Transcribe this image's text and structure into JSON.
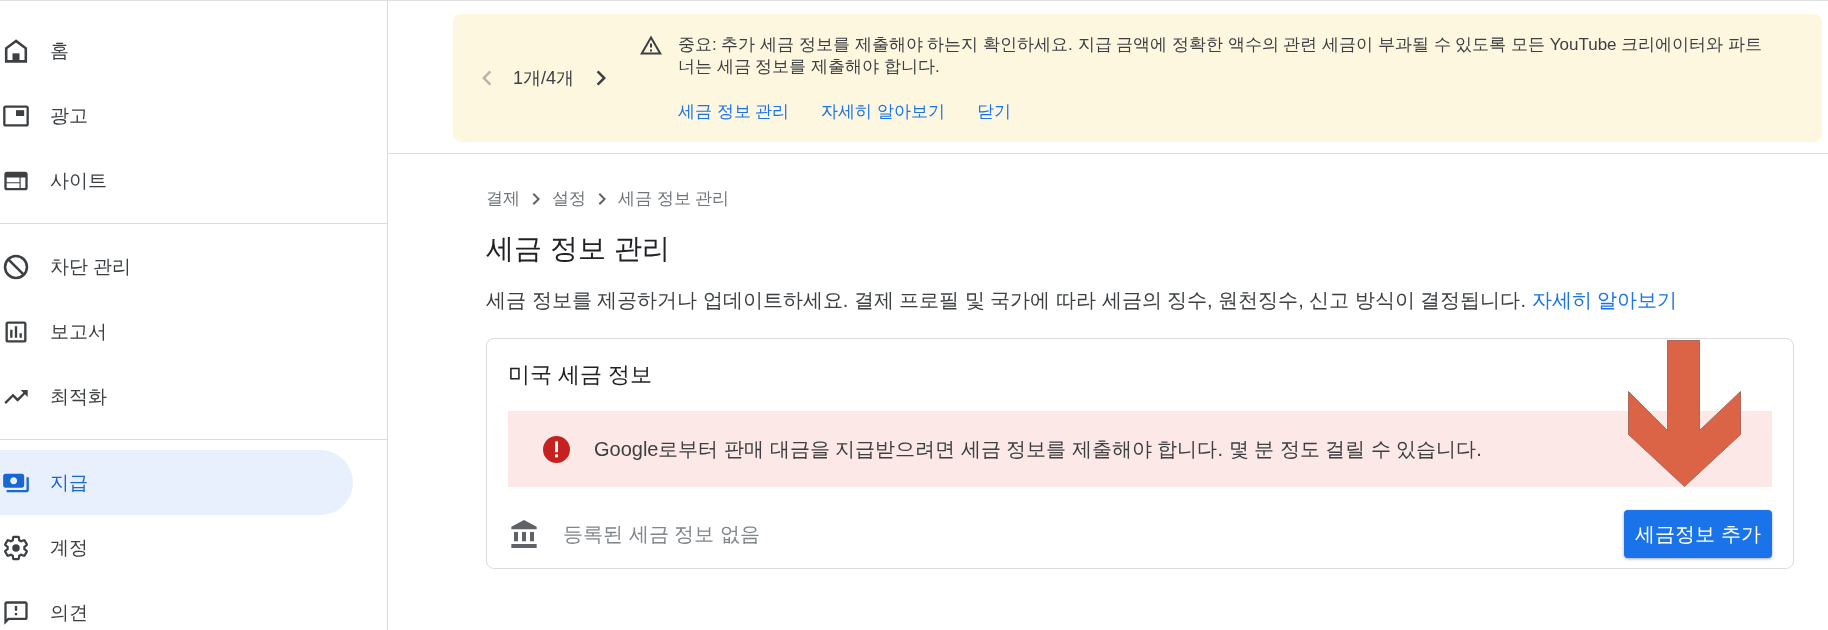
{
  "sidebar": {
    "sections": [
      {
        "items": [
          {
            "label": "홈",
            "selected": false
          },
          {
            "label": "광고",
            "selected": false
          },
          {
            "label": "사이트",
            "selected": false
          }
        ]
      },
      {
        "items": [
          {
            "label": "차단 관리",
            "selected": false
          },
          {
            "label": "보고서",
            "selected": false
          },
          {
            "label": "최적화",
            "selected": false
          }
        ]
      },
      {
        "items": [
          {
            "label": "지급",
            "selected": true
          },
          {
            "label": "계정",
            "selected": false
          },
          {
            "label": "의견",
            "selected": false
          }
        ]
      }
    ]
  },
  "notice_banner": {
    "pager": {
      "previous": {
        "disabled": true
      },
      "count": "1개/4개",
      "next": {
        "disabled": false
      }
    },
    "message": "중요: 추가 세금 정보를 제출해야 하는지 확인하세요. 지급 금액에 정확한 액수의 관련 세금이 부과될 수 있도록 모든 YouTube 크리에이터와 파트너는 세금 정보를 제출해야 합니다.",
    "links": [
      "세금 정보 관리",
      "자세히 알아보기",
      "닫기"
    ]
  },
  "breadcrumb": [
    "결제",
    "설정",
    "세금 정보 관리"
  ],
  "page_title": "세금 정보 관리",
  "description": {
    "text": "세금 정보를 제공하거나 업데이트하세요. 결제 프로필 및 국가에 따라 세금의 징수, 원천징수, 신고 방식이 결정됩니다.",
    "link": "자세히 알아보기"
  },
  "tax_card": {
    "title": "미국 세금 정보",
    "alert": "Google로부터 판매 대금을 지급받으려면 세금 정보를 제출해야 합니다. 몇 분 정도 걸릴 수 있습니다.",
    "empty_message": "등록된 세금 정보 없음",
    "button": "세금정보 추가"
  }
}
